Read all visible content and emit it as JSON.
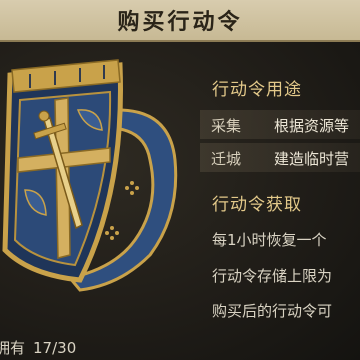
{
  "dialog": {
    "title": "购买行动令"
  },
  "usage": {
    "heading": "行动令用途",
    "rows": [
      {
        "label": "采集",
        "value": "根据资源等"
      },
      {
        "label": "迁城",
        "value": "建造临时营"
      }
    ]
  },
  "acquire": {
    "heading": "行动令获取",
    "lines": [
      "每1小时恢复一个",
      "行动令存储上限为",
      "购买后的行动令可"
    ]
  },
  "owned": {
    "label": "拥有",
    "count": "17/30"
  },
  "icon": {
    "name": "action-order-shield-icon"
  },
  "colors": {
    "accent": "#e3c98a",
    "shield_blue": "#2f4f7f",
    "gold": "#c9a24a"
  }
}
